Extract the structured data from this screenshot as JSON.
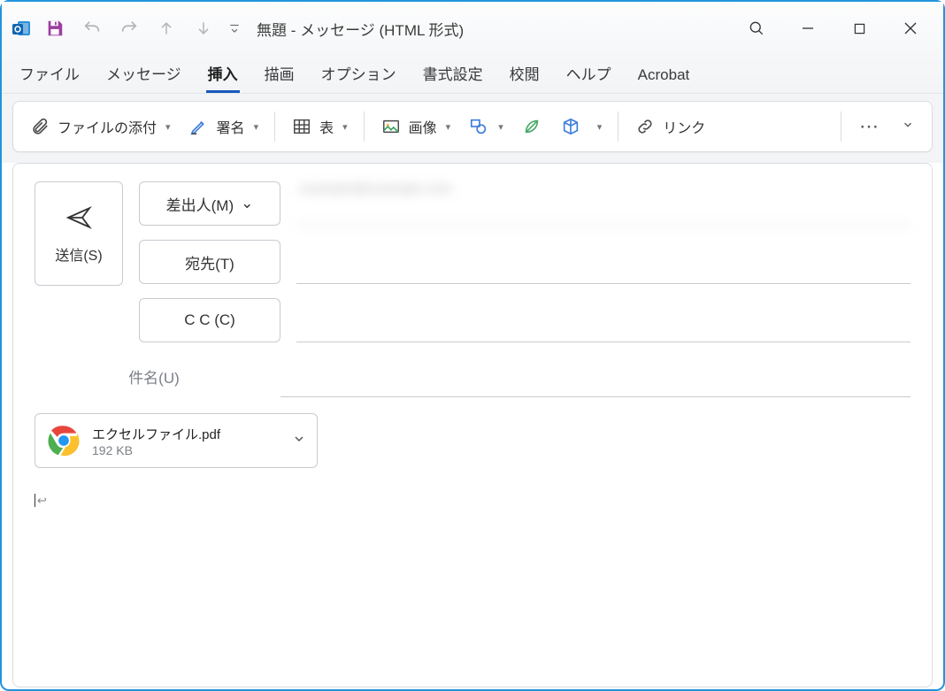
{
  "titlebar": {
    "title": "無題  -  メッセージ (HTML 形式)"
  },
  "tabs": {
    "items": [
      "ファイル",
      "メッセージ",
      "挿入",
      "描画",
      "オプション",
      "書式設定",
      "校閲",
      "ヘルプ",
      "Acrobat"
    ],
    "active_index": 2
  },
  "ribbon": {
    "attach_file": "ファイルの添付",
    "signature": "署名",
    "table": "表",
    "picture": "画像",
    "link": "リンク"
  },
  "compose": {
    "send": "送信(S)",
    "from_btn": "差出人(M)",
    "from_value": "example@example.com",
    "to_btn": "宛先(T)",
    "to_value": "",
    "cc_btn": "C C (C)",
    "cc_value": "",
    "subject_label": "件名(U)",
    "subject_value": ""
  },
  "attachment": {
    "filename": "エクセルファイル.pdf",
    "size": "192 KB"
  },
  "icons": {
    "outlook": "outlook-icon",
    "save": "save-icon",
    "undo": "undo-icon",
    "redo": "redo-icon",
    "up": "arrow-up-icon",
    "down": "arrow-down-icon",
    "dropdown": "dropdown-icon",
    "search": "search-icon",
    "minimize": "minimize-icon",
    "maximize": "maximize-icon",
    "close": "close-icon",
    "paperclip": "paperclip-icon",
    "pen": "pen-icon",
    "grid": "table-icon",
    "image": "image-icon",
    "shapes": "shapes-icon",
    "model": "model-icon",
    "cube": "cube-icon",
    "linkicon": "link-icon",
    "send_plane": "send-icon",
    "chrome": "chrome-icon"
  },
  "colors": {
    "accent": "#185abd",
    "border": "#c7cbd0",
    "muted": "#7a7f86"
  }
}
